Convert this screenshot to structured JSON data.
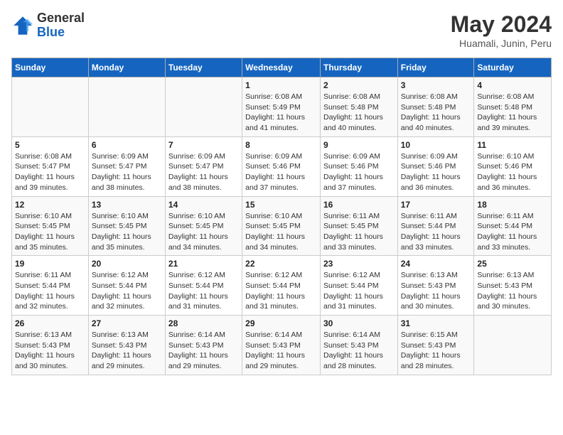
{
  "logo": {
    "general": "General",
    "blue": "Blue"
  },
  "title": "May 2024",
  "subtitle": "Huamali, Junin, Peru",
  "days_of_week": [
    "Sunday",
    "Monday",
    "Tuesday",
    "Wednesday",
    "Thursday",
    "Friday",
    "Saturday"
  ],
  "weeks": [
    [
      {
        "day": "",
        "info": ""
      },
      {
        "day": "",
        "info": ""
      },
      {
        "day": "",
        "info": ""
      },
      {
        "day": "1",
        "info": "Sunrise: 6:08 AM\nSunset: 5:49 PM\nDaylight: 11 hours and 41 minutes."
      },
      {
        "day": "2",
        "info": "Sunrise: 6:08 AM\nSunset: 5:48 PM\nDaylight: 11 hours and 40 minutes."
      },
      {
        "day": "3",
        "info": "Sunrise: 6:08 AM\nSunset: 5:48 PM\nDaylight: 11 hours and 40 minutes."
      },
      {
        "day": "4",
        "info": "Sunrise: 6:08 AM\nSunset: 5:48 PM\nDaylight: 11 hours and 39 minutes."
      }
    ],
    [
      {
        "day": "5",
        "info": "Sunrise: 6:08 AM\nSunset: 5:47 PM\nDaylight: 11 hours and 39 minutes."
      },
      {
        "day": "6",
        "info": "Sunrise: 6:09 AM\nSunset: 5:47 PM\nDaylight: 11 hours and 38 minutes."
      },
      {
        "day": "7",
        "info": "Sunrise: 6:09 AM\nSunset: 5:47 PM\nDaylight: 11 hours and 38 minutes."
      },
      {
        "day": "8",
        "info": "Sunrise: 6:09 AM\nSunset: 5:46 PM\nDaylight: 11 hours and 37 minutes."
      },
      {
        "day": "9",
        "info": "Sunrise: 6:09 AM\nSunset: 5:46 PM\nDaylight: 11 hours and 37 minutes."
      },
      {
        "day": "10",
        "info": "Sunrise: 6:09 AM\nSunset: 5:46 PM\nDaylight: 11 hours and 36 minutes."
      },
      {
        "day": "11",
        "info": "Sunrise: 6:10 AM\nSunset: 5:46 PM\nDaylight: 11 hours and 36 minutes."
      }
    ],
    [
      {
        "day": "12",
        "info": "Sunrise: 6:10 AM\nSunset: 5:45 PM\nDaylight: 11 hours and 35 minutes."
      },
      {
        "day": "13",
        "info": "Sunrise: 6:10 AM\nSunset: 5:45 PM\nDaylight: 11 hours and 35 minutes."
      },
      {
        "day": "14",
        "info": "Sunrise: 6:10 AM\nSunset: 5:45 PM\nDaylight: 11 hours and 34 minutes."
      },
      {
        "day": "15",
        "info": "Sunrise: 6:10 AM\nSunset: 5:45 PM\nDaylight: 11 hours and 34 minutes."
      },
      {
        "day": "16",
        "info": "Sunrise: 6:11 AM\nSunset: 5:45 PM\nDaylight: 11 hours and 33 minutes."
      },
      {
        "day": "17",
        "info": "Sunrise: 6:11 AM\nSunset: 5:44 PM\nDaylight: 11 hours and 33 minutes."
      },
      {
        "day": "18",
        "info": "Sunrise: 6:11 AM\nSunset: 5:44 PM\nDaylight: 11 hours and 33 minutes."
      }
    ],
    [
      {
        "day": "19",
        "info": "Sunrise: 6:11 AM\nSunset: 5:44 PM\nDaylight: 11 hours and 32 minutes."
      },
      {
        "day": "20",
        "info": "Sunrise: 6:12 AM\nSunset: 5:44 PM\nDaylight: 11 hours and 32 minutes."
      },
      {
        "day": "21",
        "info": "Sunrise: 6:12 AM\nSunset: 5:44 PM\nDaylight: 11 hours and 31 minutes."
      },
      {
        "day": "22",
        "info": "Sunrise: 6:12 AM\nSunset: 5:44 PM\nDaylight: 11 hours and 31 minutes."
      },
      {
        "day": "23",
        "info": "Sunrise: 6:12 AM\nSunset: 5:44 PM\nDaylight: 11 hours and 31 minutes."
      },
      {
        "day": "24",
        "info": "Sunrise: 6:13 AM\nSunset: 5:43 PM\nDaylight: 11 hours and 30 minutes."
      },
      {
        "day": "25",
        "info": "Sunrise: 6:13 AM\nSunset: 5:43 PM\nDaylight: 11 hours and 30 minutes."
      }
    ],
    [
      {
        "day": "26",
        "info": "Sunrise: 6:13 AM\nSunset: 5:43 PM\nDaylight: 11 hours and 30 minutes."
      },
      {
        "day": "27",
        "info": "Sunrise: 6:13 AM\nSunset: 5:43 PM\nDaylight: 11 hours and 29 minutes."
      },
      {
        "day": "28",
        "info": "Sunrise: 6:14 AM\nSunset: 5:43 PM\nDaylight: 11 hours and 29 minutes."
      },
      {
        "day": "29",
        "info": "Sunrise: 6:14 AM\nSunset: 5:43 PM\nDaylight: 11 hours and 29 minutes."
      },
      {
        "day": "30",
        "info": "Sunrise: 6:14 AM\nSunset: 5:43 PM\nDaylight: 11 hours and 28 minutes."
      },
      {
        "day": "31",
        "info": "Sunrise: 6:15 AM\nSunset: 5:43 PM\nDaylight: 11 hours and 28 minutes."
      },
      {
        "day": "",
        "info": ""
      }
    ]
  ]
}
